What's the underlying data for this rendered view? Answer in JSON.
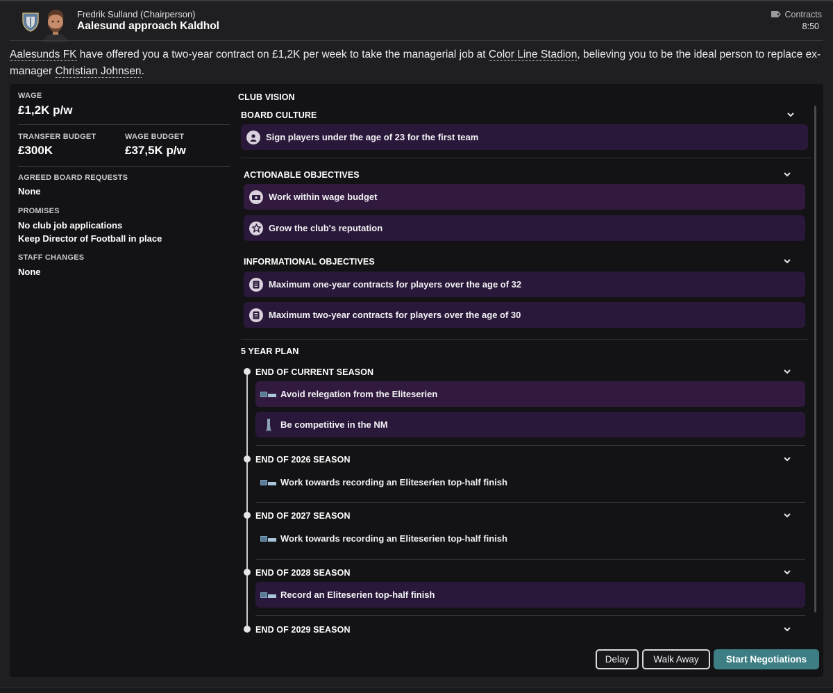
{
  "header": {
    "sender": "Fredrik Sulland  (Chairperson)",
    "subject": "Aalesund approach Kaldhol",
    "category": "Contracts",
    "time": "8:50",
    "category_icon": "tag-icon"
  },
  "message": {
    "part1": "Aalesunds FK",
    "part2": " have offered you a two-year contract on £1,2K per week to take the managerial job at ",
    "part3": "Color Line Stadion",
    "part4": ", believing you to be the ideal person to replace ex-manager ",
    "part5": "Christian Johnsen",
    "part6": "."
  },
  "offer": {
    "wage_label": "WAGE",
    "wage_value": "£1,2K p/w",
    "transfer_budget_label": "TRANSFER BUDGET",
    "transfer_budget_value": "£300K",
    "wage_budget_label": "WAGE BUDGET",
    "wage_budget_value": "£37,5K p/w",
    "board_requests_label": "AGREED BOARD REQUESTS",
    "board_requests_value": "None",
    "promises_label": "PROMISES",
    "promises": [
      "No club job applications",
      "Keep Director of Football in place"
    ],
    "staff_changes_label": "STAFF CHANGES",
    "staff_changes_value": "None"
  },
  "vision": {
    "title": "CLUB VISION",
    "board_culture": {
      "title": "BOARD CULTURE",
      "items": [
        "Sign players under the age of 23 for the first team"
      ]
    },
    "actionable": {
      "title": "ACTIONABLE OBJECTIVES",
      "items": [
        "Work within wage budget",
        "Grow the club's reputation"
      ]
    },
    "informational": {
      "title": "INFORMATIONAL OBJECTIVES",
      "items": [
        "Maximum one-year contracts for players over the age of 32",
        "Maximum two-year contracts for players over the age of 30"
      ]
    },
    "plan": {
      "title": "5 YEAR PLAN",
      "stages": [
        {
          "title": "END OF CURRENT SEASON",
          "items": [
            "Avoid relegation from the Eliteserien",
            "Be competitive in the NM"
          ]
        },
        {
          "title": "END OF 2026 SEASON",
          "items": [
            "Work towards recording an Eliteserien top-half finish"
          ]
        },
        {
          "title": "END OF 2027 SEASON",
          "items": [
            "Work towards recording an Eliteserien top-half finish"
          ]
        },
        {
          "title": "END OF 2028 SEASON",
          "items": [
            "Record an Eliteserien top-half finish"
          ]
        },
        {
          "title": "END OF 2029 SEASON",
          "items": []
        }
      ]
    }
  },
  "buttons": {
    "delay": "Delay",
    "walk_away": "Walk Away",
    "start": "Start Negotiations"
  },
  "colors": {
    "primary_button": "#3d7e85",
    "objective_bg": "#291839",
    "panel_bg": "#131316"
  }
}
